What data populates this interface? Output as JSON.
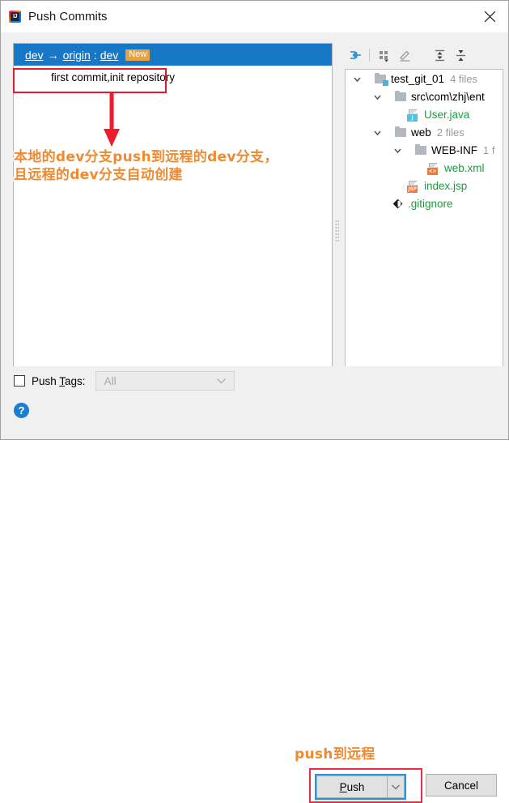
{
  "window": {
    "title": "Push Commits",
    "app_icon": "intellij-idea-icon",
    "close_icon": "close-icon"
  },
  "commit_panel": {
    "branch_row": {
      "source": "dev",
      "arrow": "→",
      "remote": "origin",
      "separator": ":",
      "destination": "dev",
      "badge": "New",
      "badge_color": "#e8a33d",
      "selected_bg": "#1878c8"
    },
    "commit_message": "first commit,init repository"
  },
  "tree_toolbar": {
    "buttons": [
      {
        "name": "collapse-diff-icon",
        "label": "Show Diff"
      },
      {
        "name": "group-by-icon",
        "label": "Group By"
      },
      {
        "name": "edit-icon",
        "label": "Edit Source"
      },
      {
        "name": "expand-all-icon",
        "label": "Expand All"
      },
      {
        "name": "collapse-all-icon",
        "label": "Collapse All"
      }
    ]
  },
  "tree": {
    "nodes": [
      {
        "label": "test_git_01",
        "count": "4 files",
        "depth": 0,
        "icon": "folder-module-icon",
        "expanded": true,
        "color": "black"
      },
      {
        "label": "src\\com\\zhj\\ent",
        "count": "",
        "depth": 1,
        "icon": "folder-icon",
        "expanded": true,
        "color": "black"
      },
      {
        "label": "User.java",
        "count": "",
        "depth": 2,
        "icon": "java-file-icon",
        "expanded": null,
        "color": "green"
      },
      {
        "label": "web",
        "count": "2 files",
        "depth": 1,
        "icon": "folder-icon",
        "expanded": true,
        "color": "black"
      },
      {
        "label": "WEB-INF",
        "count": "1 f",
        "depth": 2,
        "icon": "folder-icon",
        "expanded": true,
        "color": "black"
      },
      {
        "label": "web.xml",
        "count": "",
        "depth": 3,
        "icon": "xml-file-icon",
        "expanded": null,
        "color": "green"
      },
      {
        "label": "index.jsp",
        "count": "",
        "depth": 2,
        "icon": "jsp-file-icon",
        "expanded": null,
        "color": "green"
      },
      {
        "label": ".gitignore",
        "count": "",
        "depth": 1,
        "icon": "git-file-icon",
        "expanded": null,
        "color": "green"
      }
    ]
  },
  "footer": {
    "push_tags_label_pre": "Push ",
    "push_tags_label_underlined": "T",
    "push_tags_label_post": "ags:",
    "push_tags_checked": false,
    "push_tags_value": "All",
    "push_tags_enabled": false,
    "help_icon": "help-icon",
    "push_button_pre": "",
    "push_button_underlined": "P",
    "push_button_post": "ush",
    "push_dropdown_icon": "chevron-down-icon",
    "cancel_button": "Cancel"
  },
  "annotations": [
    {
      "name": "annotation-branch-explainer",
      "text_line1": "本地的dev分支push到远程的dev分支，",
      "text_line2": "且远程的dev分支自动创建",
      "color": "#f08a30"
    },
    {
      "name": "annotation-push-remote",
      "text": "push到远程",
      "color": "#f08a30"
    }
  ],
  "highlight_color": "#e8192c",
  "focus_color": "#2196e3"
}
